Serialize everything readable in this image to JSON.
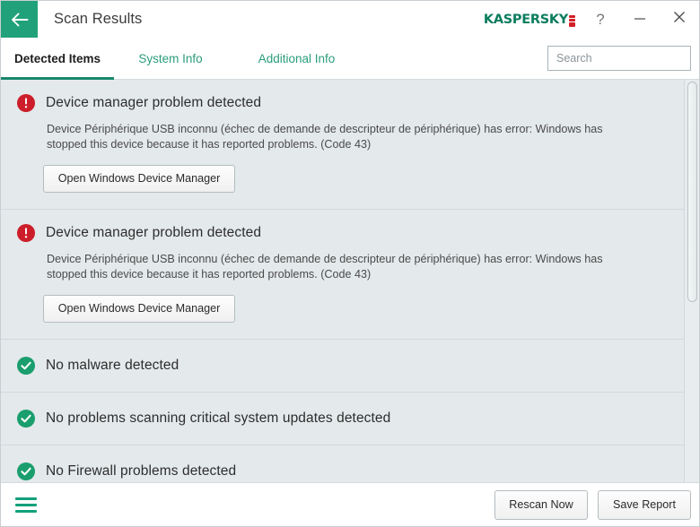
{
  "window": {
    "title": "Scan Results",
    "back_icon": "arrow-left-icon",
    "brand": "KASPERSKY",
    "controls": {
      "help": "?",
      "minimize": "—",
      "close": "✕"
    }
  },
  "tabs": [
    {
      "label": "Detected Items",
      "active": true
    },
    {
      "label": "System Info",
      "active": false
    },
    {
      "label": "Additional Info",
      "active": false
    }
  ],
  "search": {
    "value": "",
    "placeholder": "Search",
    "icon": "search-icon"
  },
  "results": [
    {
      "status": "error",
      "title": "Device manager problem detected",
      "description": "Device Périphérique USB inconnu (échec de demande de descripteur de périphérique) has error: Windows has stopped this device because it has reported problems. (Code 43)",
      "action": "Open Windows Device Manager"
    },
    {
      "status": "error",
      "title": "Device manager problem detected",
      "description": "Device Périphérique USB inconnu (échec de demande de descripteur de périphérique) has error: Windows has stopped this device because it has reported problems. (Code 43)",
      "action": "Open Windows Device Manager"
    },
    {
      "status": "ok",
      "title": "No malware detected",
      "description": "",
      "action": ""
    },
    {
      "status": "ok",
      "title": "No problems scanning critical system updates detected",
      "description": "",
      "action": ""
    },
    {
      "status": "ok",
      "title": "No Firewall problems detected",
      "description": "",
      "action": ""
    }
  ],
  "footer": {
    "menu_icon": "hamburger-menu-icon",
    "rescan_label": "Rescan Now",
    "save_label": "Save Report"
  },
  "colors": {
    "brand_green": "#21a179",
    "brand_red": "#d21f26",
    "tab_green": "#2a9d7c",
    "tab_underline": "#17876a",
    "error_red": "#cc1e2a",
    "ok_green": "#1a9e6e",
    "content_bg": "#e4e9eb"
  }
}
